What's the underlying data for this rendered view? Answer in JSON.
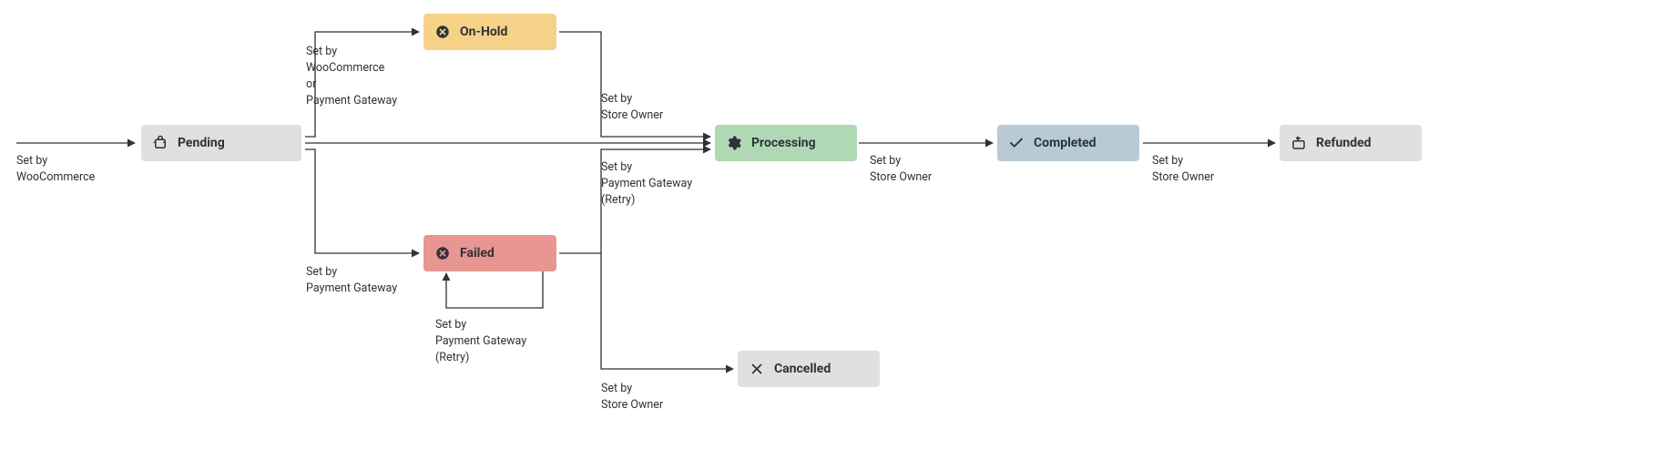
{
  "nodes": {
    "pending": {
      "label": "Pending",
      "bg": "#e0e0e0",
      "fg": "#2c3338"
    },
    "on_hold": {
      "label": "On-Hold",
      "bg": "#f6d288",
      "fg": "#2c3338"
    },
    "failed": {
      "label": "Failed",
      "bg": "#e79691",
      "fg": "#2c3338"
    },
    "processing": {
      "label": "Processing",
      "bg": "#afd9b4",
      "fg": "#2c3338"
    },
    "completed": {
      "label": "Completed",
      "bg": "#b7cad6",
      "fg": "#2c3338"
    },
    "cancelled": {
      "label": "Cancelled",
      "bg": "#e0e0e0",
      "fg": "#2c3338"
    },
    "refunded": {
      "label": "Refunded",
      "bg": "#e0e0e0",
      "fg": "#2c3338"
    }
  },
  "edge_labels": {
    "to_pending": "Set by\nWooCommerce",
    "pending_to_onhold": "Set by\nWooCommerce\nor\nPayment Gateway",
    "pending_to_failed": "Set by\nPayment Gateway",
    "failed_retry": "Set by\nPayment Gateway\n(Retry)",
    "onhold_to_processing": "Set by\nStore Owner",
    "failed_to_processing": "Set by\nPayment Gateway\n(Retry)",
    "failed_to_cancelled": "Set by\nStore Owner",
    "processing_to_completed": "Set by\nStore Owner",
    "completed_to_refunded": "Set by\nStore Owner"
  }
}
